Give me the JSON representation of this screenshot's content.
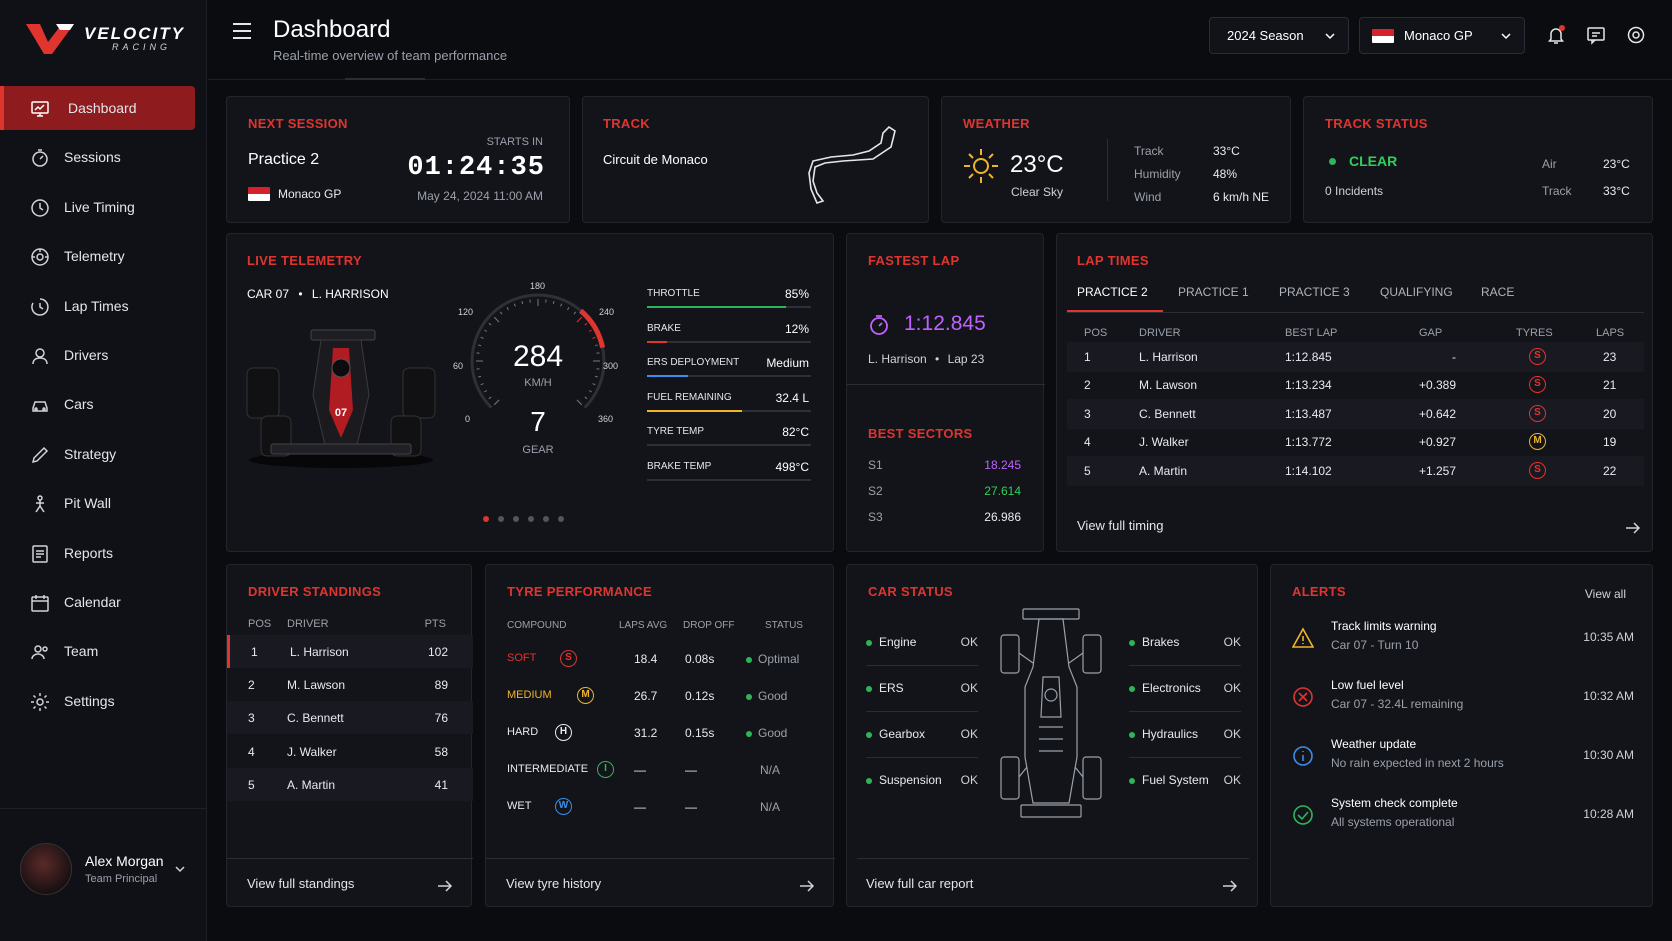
{
  "brand": {
    "name": "VELOCITY",
    "sub": "RACING"
  },
  "nav": [
    {
      "label": "Dashboard",
      "icon": "monitor-icon"
    },
    {
      "label": "Sessions",
      "icon": "stopwatch-icon"
    },
    {
      "label": "Live Timing",
      "icon": "clock-icon"
    },
    {
      "label": "Telemetry",
      "icon": "gauge-icon"
    },
    {
      "label": "Lap Times",
      "icon": "lap-timer-icon"
    },
    {
      "label": "Drivers",
      "icon": "driver-icon"
    },
    {
      "label": "Cars",
      "icon": "car-icon"
    },
    {
      "label": "Strategy",
      "icon": "pencil-icon"
    },
    {
      "label": "Pit Wall",
      "icon": "pit-wall-icon"
    },
    {
      "label": "Reports",
      "icon": "report-icon"
    },
    {
      "label": "Calendar",
      "icon": "calendar-icon"
    },
    {
      "label": "Team",
      "icon": "team-icon"
    },
    {
      "label": "Settings",
      "icon": "gear-icon"
    }
  ],
  "user": {
    "name": "Alex Morgan",
    "role": "Team Principal"
  },
  "header": {
    "title": "Dashboard",
    "subtitle": "Real-time overview of team performance",
    "season": "2024 Season",
    "event": "Monaco GP"
  },
  "next_session": {
    "title": "NEXT SESSION",
    "name": "Practice 2",
    "location": "Monaco GP",
    "starts_label": "STARTS IN",
    "countdown": "01:24:35",
    "datetime": "May 24, 2024 11:00 AM"
  },
  "track": {
    "title": "TRACK",
    "name": "Circuit de Monaco"
  },
  "weather": {
    "title": "WEATHER",
    "temp": "23°C",
    "condition": "Clear Sky",
    "rows": [
      {
        "label": "Track",
        "value": "33°C"
      },
      {
        "label": "Humidity",
        "value": "48%"
      },
      {
        "label": "Wind",
        "value": "6 km/h NE"
      }
    ]
  },
  "track_status": {
    "title": "TRACK STATUS",
    "status": "CLEAR",
    "incidents": "0 Incidents",
    "air_label": "Air",
    "air": "23°C",
    "track_label": "Track",
    "track": "33°C"
  },
  "telemetry": {
    "title": "LIVE TELEMETRY",
    "car": "CAR 07",
    "driver": "L. HARRISON",
    "car_number": "07",
    "speed": "284",
    "speed_unit": "KM/H",
    "gear": "7",
    "gear_label": "GEAR",
    "speed_fraction": 0.79,
    "ticks": [
      "0",
      "60",
      "120",
      "180",
      "240",
      "300",
      "360"
    ],
    "metrics": [
      {
        "label": "THROTTLE",
        "value": "85%",
        "level": 0.85,
        "color": "#2fb45a"
      },
      {
        "label": "BRAKE",
        "value": "12%",
        "level": 0.12,
        "color": "#e0342f"
      },
      {
        "label": "ERS DEPLOYMENT",
        "value": "Medium",
        "level": 0.25,
        "color": "#3b8ee8"
      },
      {
        "label": "FUEL REMAINING",
        "value": "32.4 L",
        "level": 0.58,
        "color": "#f0b429"
      },
      {
        "label": "TYRE TEMP",
        "value": "82°C",
        "level": 0,
        "color": "#2e3038"
      },
      {
        "label": "BRAKE TEMP",
        "value": "498°C",
        "level": 0,
        "color": "#2e3038"
      }
    ]
  },
  "fastest_lap": {
    "title": "FASTEST LAP",
    "time": "1:12.845",
    "driver": "L. Harrison",
    "lap": "Lap 23",
    "sectors_title": "BEST SECTORS",
    "sectors": [
      {
        "label": "S1",
        "value": "18.245",
        "color": "#c061ff"
      },
      {
        "label": "S2",
        "value": "27.614",
        "color": "#2fd05a"
      },
      {
        "label": "S3",
        "value": "26.986",
        "color": "#e9eaee"
      }
    ]
  },
  "lap_times": {
    "title": "LAP TIMES",
    "tabs": [
      "PRACTICE 2",
      "PRACTICE 1",
      "PRACTICE 3",
      "QUALIFYING",
      "RACE"
    ],
    "columns": [
      "POS",
      "DRIVER",
      "BEST LAP",
      "GAP",
      "TYRES",
      "LAPS"
    ],
    "rows": [
      {
        "pos": "1",
        "driver": "L. Harrison",
        "best": "1:12.845",
        "gap": "-",
        "tyre": "S",
        "tyre_color": "#e0342f",
        "laps": "23"
      },
      {
        "pos": "2",
        "driver": "M. Lawson",
        "best": "1:13.234",
        "gap": "+0.389",
        "tyre": "S",
        "tyre_color": "#e0342f",
        "laps": "21"
      },
      {
        "pos": "3",
        "driver": "C. Bennett",
        "best": "1:13.487",
        "gap": "+0.642",
        "tyre": "S",
        "tyre_color": "#e0342f",
        "laps": "20"
      },
      {
        "pos": "4",
        "driver": "J. Walker",
        "best": "1:13.772",
        "gap": "+0.927",
        "tyre": "M",
        "tyre_color": "#f0b429",
        "laps": "19"
      },
      {
        "pos": "5",
        "driver": "A. Martin",
        "best": "1:14.102",
        "gap": "+1.257",
        "tyre": "S",
        "tyre_color": "#e0342f",
        "laps": "22"
      }
    ],
    "link": "View full timing"
  },
  "standings": {
    "title": "DRIVER STANDINGS",
    "columns": [
      "POS",
      "DRIVER",
      "PTS"
    ],
    "rows": [
      {
        "pos": "1",
        "driver": "L. Harrison",
        "pts": "102"
      },
      {
        "pos": "2",
        "driver": "M. Lawson",
        "pts": "89"
      },
      {
        "pos": "3",
        "driver": "C. Bennett",
        "pts": "76"
      },
      {
        "pos": "4",
        "driver": "J. Walker",
        "pts": "58"
      },
      {
        "pos": "5",
        "driver": "A. Martin",
        "pts": "41"
      }
    ],
    "link": "View full standings"
  },
  "tyres": {
    "title": "TYRE PERFORMANCE",
    "columns": [
      "COMPOUND",
      "LAPS AVG",
      "DROP OFF",
      "STATUS"
    ],
    "rows": [
      {
        "compound": "SOFT",
        "letter": "S",
        "color": "#e0342f",
        "laps": "18.4",
        "drop": "0.08s",
        "status": "Optimal",
        "dot": true
      },
      {
        "compound": "MEDIUM",
        "letter": "M",
        "color": "#f0b429",
        "laps": "26.7",
        "drop": "0.12s",
        "status": "Good",
        "dot": true
      },
      {
        "compound": "HARD",
        "letter": "H",
        "color": "#e9eaee",
        "laps": "31.2",
        "drop": "0.15s",
        "status": "Good",
        "dot": true
      },
      {
        "compound": "INTERMEDIATE",
        "letter": "I",
        "color": "#2fb45a",
        "laps": "—",
        "drop": "—",
        "status": "N/A",
        "dot": false
      },
      {
        "compound": "WET",
        "letter": "W",
        "color": "#3b8ee8",
        "laps": "—",
        "drop": "—",
        "status": "N/A",
        "dot": false
      }
    ],
    "link": "View tyre history"
  },
  "car_status": {
    "title": "CAR STATUS",
    "left": [
      {
        "label": "Engine",
        "value": "OK"
      },
      {
        "label": "ERS",
        "value": "OK"
      },
      {
        "label": "Gearbox",
        "value": "OK"
      },
      {
        "label": "Suspension",
        "value": "OK"
      }
    ],
    "right": [
      {
        "label": "Brakes",
        "value": "OK"
      },
      {
        "label": "Electronics",
        "value": "OK"
      },
      {
        "label": "Hydraulics",
        "value": "OK"
      },
      {
        "label": "Fuel System",
        "value": "OK"
      }
    ],
    "link": "View full car report"
  },
  "alerts": {
    "title": "ALERTS",
    "view_all": "View all",
    "items": [
      {
        "title": "Track limits warning",
        "detail": "Car 07 - Turn 10",
        "time": "10:35 AM",
        "icon": "warning-icon",
        "color": "#f0b429"
      },
      {
        "title": "Low fuel level",
        "detail": "Car 07 - 32.4L remaining",
        "time": "10:32 AM",
        "icon": "error-icon",
        "color": "#e0342f"
      },
      {
        "title": "Weather update",
        "detail": "No rain expected in next 2 hours",
        "time": "10:30 AM",
        "icon": "info-icon",
        "color": "#3b8ee8"
      },
      {
        "title": "System check complete",
        "detail": "All systems operational",
        "time": "10:28 AM",
        "icon": "check-icon",
        "color": "#2fb45a"
      }
    ]
  }
}
